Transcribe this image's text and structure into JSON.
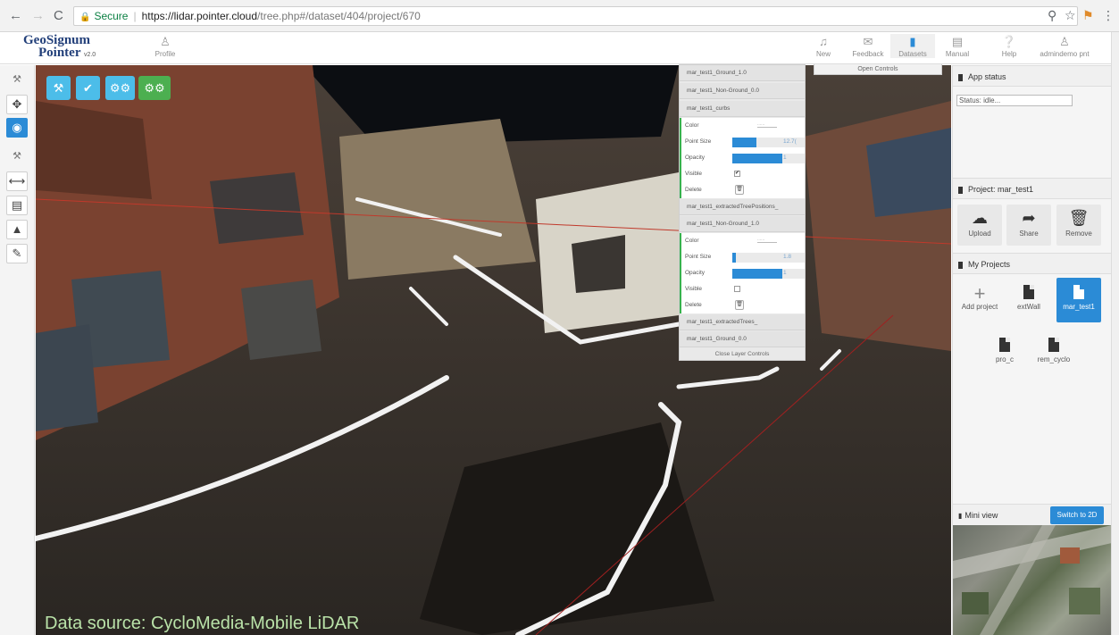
{
  "browser": {
    "back": "←",
    "forward": "→",
    "reload": "C",
    "secure_label": "Secure",
    "url_host": "https://lidar.pointer.cloud",
    "url_path": "/tree.php#/dataset/404/project/670"
  },
  "app": {
    "logo_line1": "GeoSignum",
    "logo_line2": "Pointer",
    "logo_version": "v2.0",
    "profile_label": "Profile",
    "nav": [
      {
        "label": "New",
        "icon": "bell-icon"
      },
      {
        "label": "Feedback",
        "icon": "envelope-icon"
      },
      {
        "label": "Datasets",
        "icon": "file-icon"
      },
      {
        "label": "Manual",
        "icon": "book-icon"
      },
      {
        "label": "Help",
        "icon": "question-icon"
      },
      {
        "label": "admindemo pnt",
        "icon": "user-icon"
      }
    ],
    "open_controls": "Open Controls"
  },
  "layers": {
    "items": [
      "mar_test1_Ground_1.0",
      "mar_test1_Non-Ground_0.0",
      "mar_test1_curbs",
      "mar_test1_extractedTreePositions_",
      "mar_test1_Non-Ground_1.0",
      "mar_test1_extractedTrees_",
      "mar_test1_Ground_0.0"
    ],
    "curbs": {
      "color_label": "Color",
      "point_size_label": "Point Size",
      "point_size_value": "12.7(",
      "point_size_fraction": 0.48,
      "opacity_label": "Opacity",
      "opacity_value": "1",
      "opacity_fraction": 1.0,
      "visible_label": "Visible",
      "visible": true,
      "delete_label": "Delete"
    },
    "nonground": {
      "color_label": "Color",
      "point_size_label": "Point Size",
      "point_size_value": "1.8",
      "point_size_fraction": 0.07,
      "opacity_label": "Opacity",
      "opacity_value": "1",
      "opacity_fraction": 1.0,
      "visible_label": "Visible",
      "visible": false,
      "delete_label": "Delete"
    },
    "close_label": "Close Layer Controls"
  },
  "toolbar": {
    "tools_buttons": [
      "wrench",
      "check",
      "gears",
      "gears"
    ]
  },
  "sidebar": {
    "app_status_title": "App status",
    "status_text": "Status: idle...",
    "project_title": "Project: mar_test1",
    "project_buttons": [
      {
        "label": "Upload",
        "icon": "cloud-upload-icon"
      },
      {
        "label": "Share",
        "icon": "share-icon"
      },
      {
        "label": "Remove",
        "icon": "trash-icon"
      }
    ],
    "my_projects_title": "My Projects",
    "projects": [
      "Add project",
      "extWall",
      "mar_test1",
      "pro_c",
      "rem_cyclo"
    ],
    "mini_view_title": "Mini view",
    "switch_label": "Switch to 2D"
  },
  "viewport": {
    "data_source": "Data source: CycloMedia-Mobile LiDAR"
  },
  "colors": {
    "accent": "#2b8bd6",
    "tool_blue": "#4cbde9",
    "tool_green": "#4caf50",
    "active_layer_border": "#37b24d"
  }
}
